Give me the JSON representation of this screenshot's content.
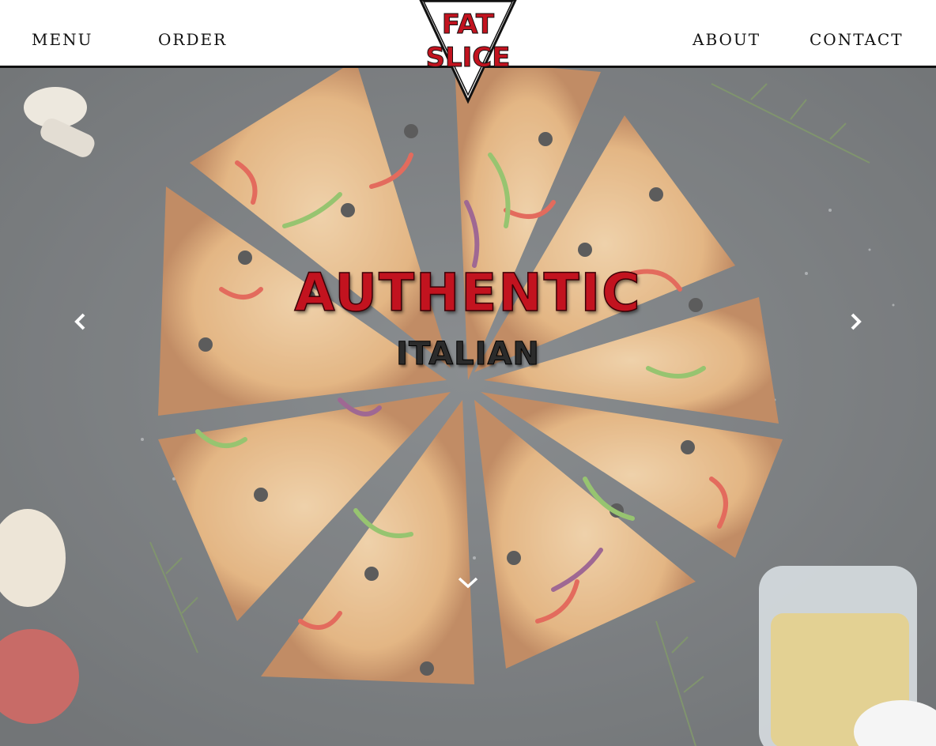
{
  "nav": {
    "menu": "MENU",
    "order": "ORDER",
    "about": "ABOUT",
    "contact": "CONTACT"
  },
  "logo": {
    "line1": "FAT",
    "line2": "SLICE"
  },
  "hero": {
    "headline": "AUTHENTIC",
    "subheadline": "ITALIAN"
  },
  "colors": {
    "brand_red": "#c2131f",
    "header_bg": "#ffffff",
    "header_border": "#111111",
    "hero_bg": "#4d5256"
  },
  "icons": {
    "prev": "chevron-left-icon",
    "next": "chevron-right-icon",
    "scroll": "chevron-down-icon"
  }
}
